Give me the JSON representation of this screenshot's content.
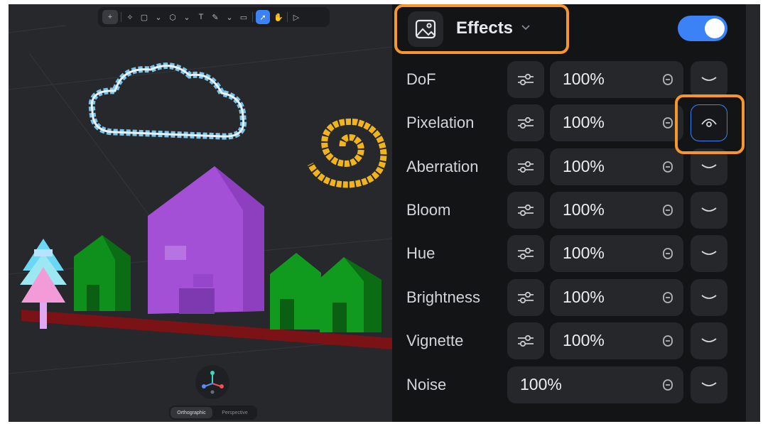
{
  "viewport": {
    "toolbar_tools": [
      "add-icon",
      "magic-icon",
      "rectangle-icon",
      "chevron-down-icon",
      "shape-icon",
      "chevron-down-icon",
      "text-icon",
      "paint-icon",
      "chevron-down-icon",
      "comment-icon",
      "select-icon",
      "hand-icon",
      "play-icon"
    ],
    "view_toggle": {
      "orthographic": "Orthographic",
      "perspective": "Perspective",
      "active": "Orthographic"
    }
  },
  "panel": {
    "title": "Effects",
    "enabled": true,
    "accent_color": "#3b82f6",
    "highlight_color": "#f7962e",
    "effects": [
      {
        "label": "DoF",
        "value": "100%",
        "has_adjust": true,
        "visibility_active": false
      },
      {
        "label": "Pixelation",
        "value": "100%",
        "has_adjust": true,
        "visibility_active": true
      },
      {
        "label": "Aberration",
        "value": "100%",
        "has_adjust": true,
        "visibility_active": false
      },
      {
        "label": "Bloom",
        "value": "100%",
        "has_adjust": true,
        "visibility_active": false
      },
      {
        "label": "Hue",
        "value": "100%",
        "has_adjust": true,
        "visibility_active": false
      },
      {
        "label": "Brightness",
        "value": "100%",
        "has_adjust": true,
        "visibility_active": false
      },
      {
        "label": "Vignette",
        "value": "100%",
        "has_adjust": true,
        "visibility_active": false
      },
      {
        "label": "Noise",
        "value": "100%",
        "has_adjust": false,
        "visibility_active": false
      }
    ]
  }
}
